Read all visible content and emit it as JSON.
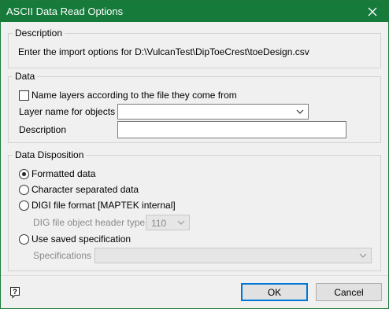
{
  "window": {
    "title": "ASCII Data Read Options"
  },
  "description_group": {
    "label": "Description",
    "text": "Enter the import options for D:\\VulcanTest\\DipToeCrest\\toeDesign.csv"
  },
  "data_group": {
    "label": "Data",
    "name_layers_checkbox": {
      "label": "Name layers according to the file they come from",
      "checked": false
    },
    "layer_name_label": "Layer name for objects",
    "layer_name_value": "",
    "description_label": "Description",
    "description_value": ""
  },
  "disposition_group": {
    "label": "Data Disposition",
    "options": [
      {
        "label": "Formatted data",
        "selected": true
      },
      {
        "label": "Character separated data",
        "selected": false
      },
      {
        "label": "DIGI file format [MAPTEK internal]",
        "selected": false
      },
      {
        "label": "Use saved specification",
        "selected": false
      }
    ],
    "dig_header_label": "DIG file object header type",
    "dig_header_value": "110",
    "specifications_label": "Specifications",
    "specifications_value": ""
  },
  "buttons": {
    "ok": "OK",
    "cancel": "Cancel"
  },
  "icons": {
    "close": "close-icon",
    "help": "help-icon",
    "dropdown": "chevron-down-icon"
  },
  "colors": {
    "titlebar": "#157a3a",
    "default_button_border": "#0078d7"
  }
}
